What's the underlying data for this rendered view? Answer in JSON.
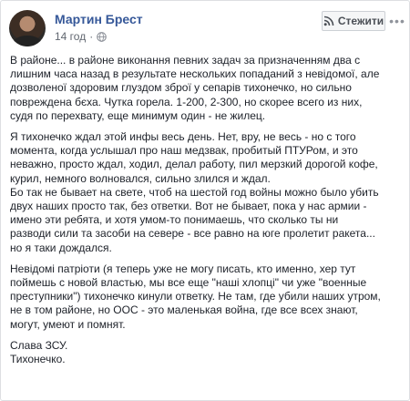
{
  "post": {
    "author": "Мартин Брест",
    "timestamp": "14 год",
    "follow_label": "Стежити",
    "paragraphs": [
      [
        "В районе... в районе виконання певних задач за призначенням два с",
        "лишним часа назад в результате нескольких попаданий з невідомої, але",
        "дозволеної здоровим глуздом зброї у сепарів тихонечко, но сильно",
        "повреждена бєха. Чутка горела. 1-200, 2-300, но скорее всего из них,",
        "судя по перехвату, еще минимум один - не жилец."
      ],
      [
        "Я тихонечко ждал этой инфы весь день. Нет, вру, не весь - но с того",
        "момента, когда услышал про наш медзвак, пробитый ПТУРом, и это",
        "неважно, просто ждал, ходил, делал работу, пил мерзкий дорогой кофе,",
        "курил, немного волновался, сильно злился и ждал.",
        "Бо так не бывает на свете, чтоб на шестой год войны можно было убить",
        "двух наших просто так, без ответки. Вот не бывает, пока у нас армии -",
        "имено эти ребята, и хотя умом-то понимаешь, что сколько ты ни",
        "разводи сили та засоби на севере - все равно на юге пролетит ракета...",
        "но я таки дождался."
      ],
      [
        "Невідомі патріоти (я теперь уже не могу писать, кто именно, хер тут",
        "поймешь с новой властью, мы все еще \"наші хлопці\" чи уже \"военные",
        "преступники\") тихонечко кинули ответку. Не там, где убили наших утром,",
        "не в том районе, но ООС - это маленькая война, где все всех знают,",
        "могут, умеют и помнят."
      ],
      [
        "Слава ЗСУ.",
        "Тихонечко."
      ]
    ]
  },
  "icons": {
    "globe": "globe-icon",
    "follow": "rss-follow-icon",
    "more": "more-options-icon"
  },
  "colors": {
    "author": "#365899",
    "meta": "#616770",
    "text": "#1d2129",
    "border": "#dddfe2"
  }
}
